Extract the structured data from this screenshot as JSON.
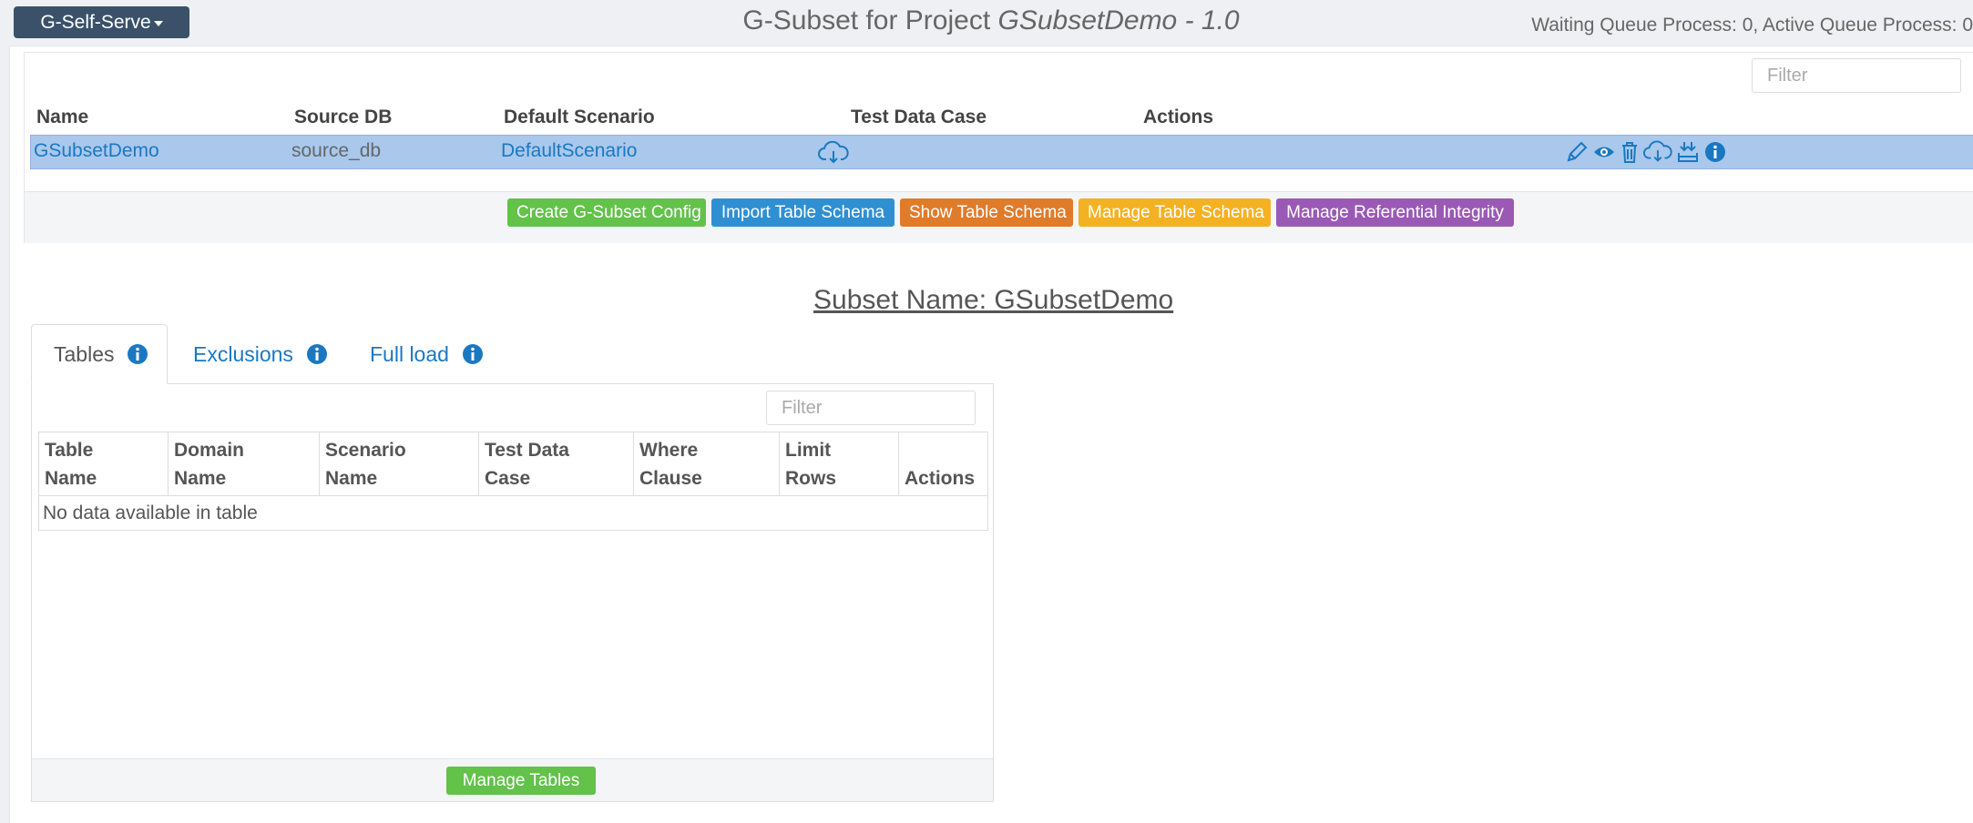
{
  "header": {
    "app_menu_label": "G-Self-Serve",
    "title_prefix": "G-Subset for Project ",
    "title_project": "GSubsetDemo - 1.0",
    "queue_status": "Waiting Queue Process: 0, Active Queue Process: 0"
  },
  "projects": {
    "filter_placeholder": "Filter",
    "columns": [
      "Name",
      "Source DB",
      "Default Scenario",
      "Test Data Case",
      "Actions"
    ],
    "rows": [
      {
        "name": "GSubsetDemo",
        "source_db": "source_db",
        "default_scenario": "DefaultScenario",
        "test_data_case_icon": "cloud-download-icon",
        "action_icons": [
          "pencil-icon",
          "eye-icon",
          "trash-icon",
          "cloud-download-icon",
          "download-tray-icon",
          "info-icon"
        ]
      }
    ],
    "buttons": {
      "create": "Create G-Subset Config",
      "import": "Import Table Schema",
      "show": "Show Table Schema",
      "manage": "Manage Table Schema",
      "referential": "Manage Referential Integrity"
    }
  },
  "subset": {
    "title": "Subset Name: GSubsetDemo",
    "tabs": [
      {
        "label": "Tables",
        "active": true
      },
      {
        "label": "Exclusions",
        "active": false
      },
      {
        "label": "Full load",
        "active": false
      }
    ],
    "filter_placeholder": "Filter",
    "columns": [
      {
        "line1": "Table",
        "line2": "Name"
      },
      {
        "line1": "Domain",
        "line2": "Name"
      },
      {
        "line1": "Scenario",
        "line2": "Name"
      },
      {
        "line1": "Test Data",
        "line2": "Case"
      },
      {
        "line1": "Where",
        "line2": "Clause"
      },
      {
        "line1": "Limit",
        "line2": "Rows"
      },
      {
        "line1": "",
        "line2": "Actions"
      }
    ],
    "empty_message": "No data available in table",
    "manage_button": "Manage Tables"
  },
  "colors": {
    "app_menu": "#3a5169",
    "link": "#1a78c2",
    "row_highlight": "#a9c8ec",
    "green": "#62c24a",
    "blue": "#2f8fd3",
    "orange": "#e07b2a",
    "yellow": "#f4b122",
    "purple": "#9b59b6"
  }
}
